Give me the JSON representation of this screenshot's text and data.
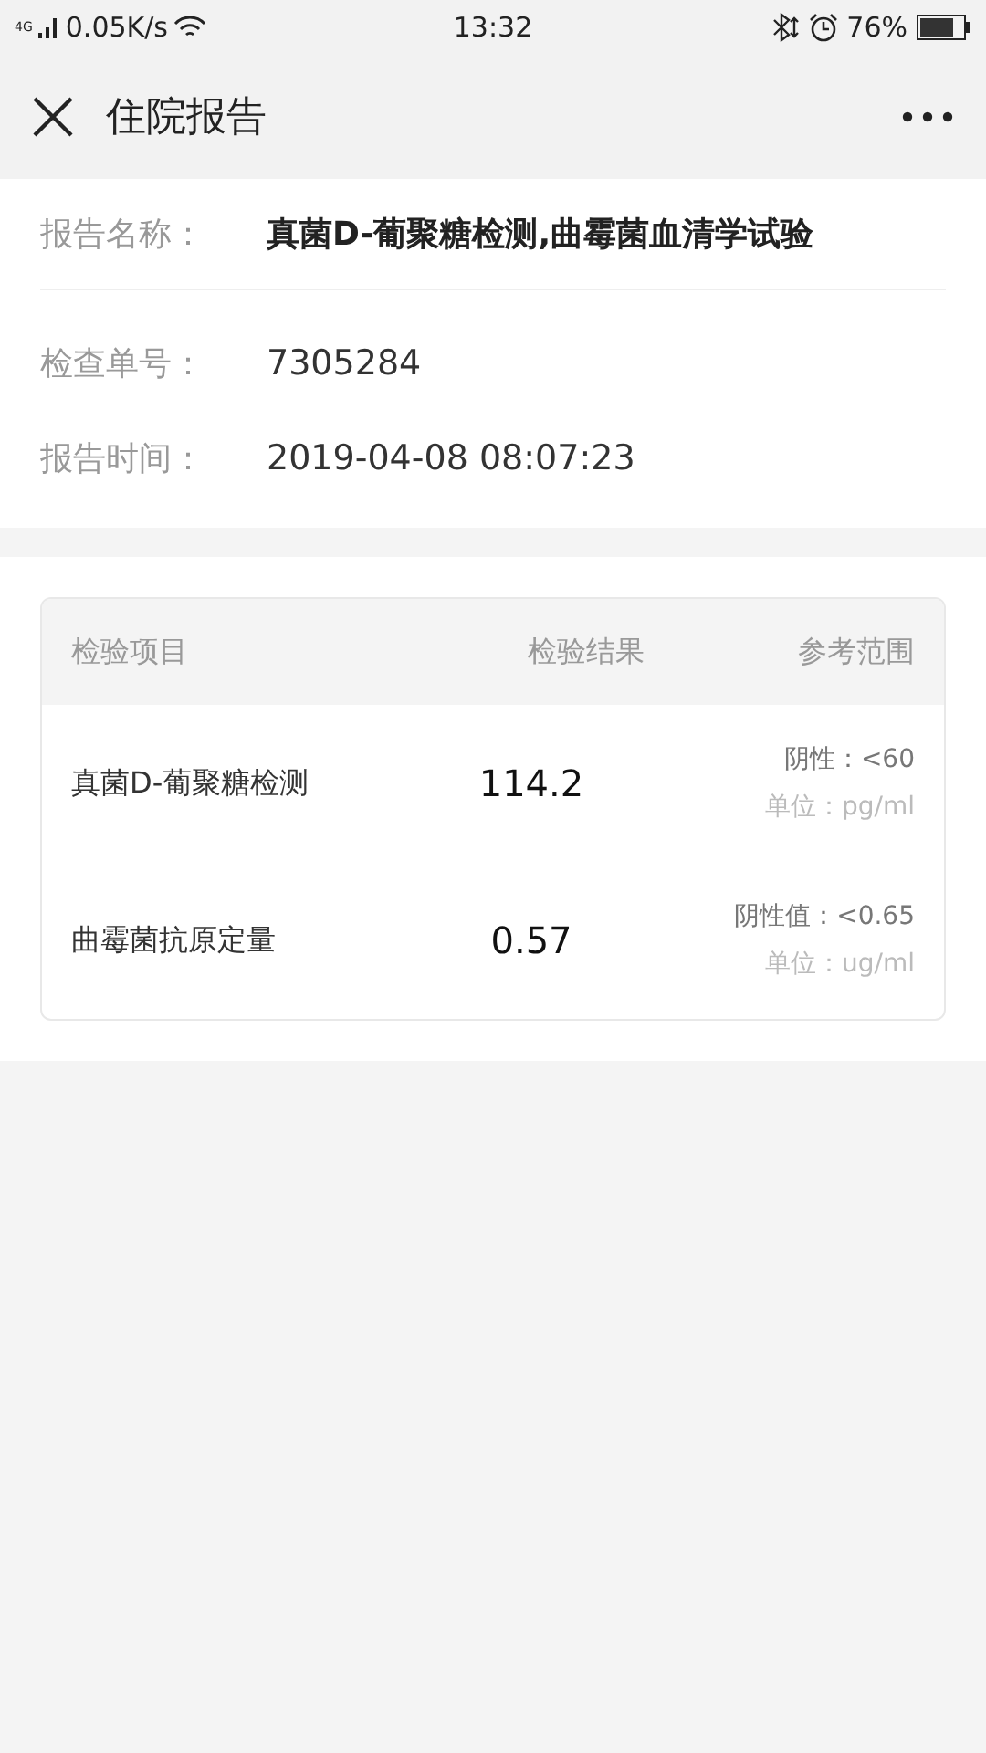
{
  "status_bar": {
    "network": "4G",
    "speed": "0.05K/s",
    "time": "13:32",
    "battery": "76%"
  },
  "header": {
    "title": "住院报告"
  },
  "report": {
    "name_label": "报告名称：",
    "name": "真菌D-葡聚糖检测,曲霉菌血清学试验",
    "fields": [
      {
        "label": "检查单号：",
        "value": "7305284"
      },
      {
        "label": "报告时间：",
        "value": "2019-04-08 08:07:23"
      }
    ]
  },
  "table": {
    "columns": [
      "检验项目",
      "检验结果",
      "参考范围"
    ],
    "rows": [
      {
        "item": "真菌D-葡聚糖检测",
        "result": "114.2",
        "reference": "阴性：<60",
        "unit": "单位：pg/ml"
      },
      {
        "item": "曲霉菌抗原定量",
        "result": "0.57",
        "reference": "阴性值：<0.65",
        "unit": "单位：ug/ml"
      }
    ]
  }
}
